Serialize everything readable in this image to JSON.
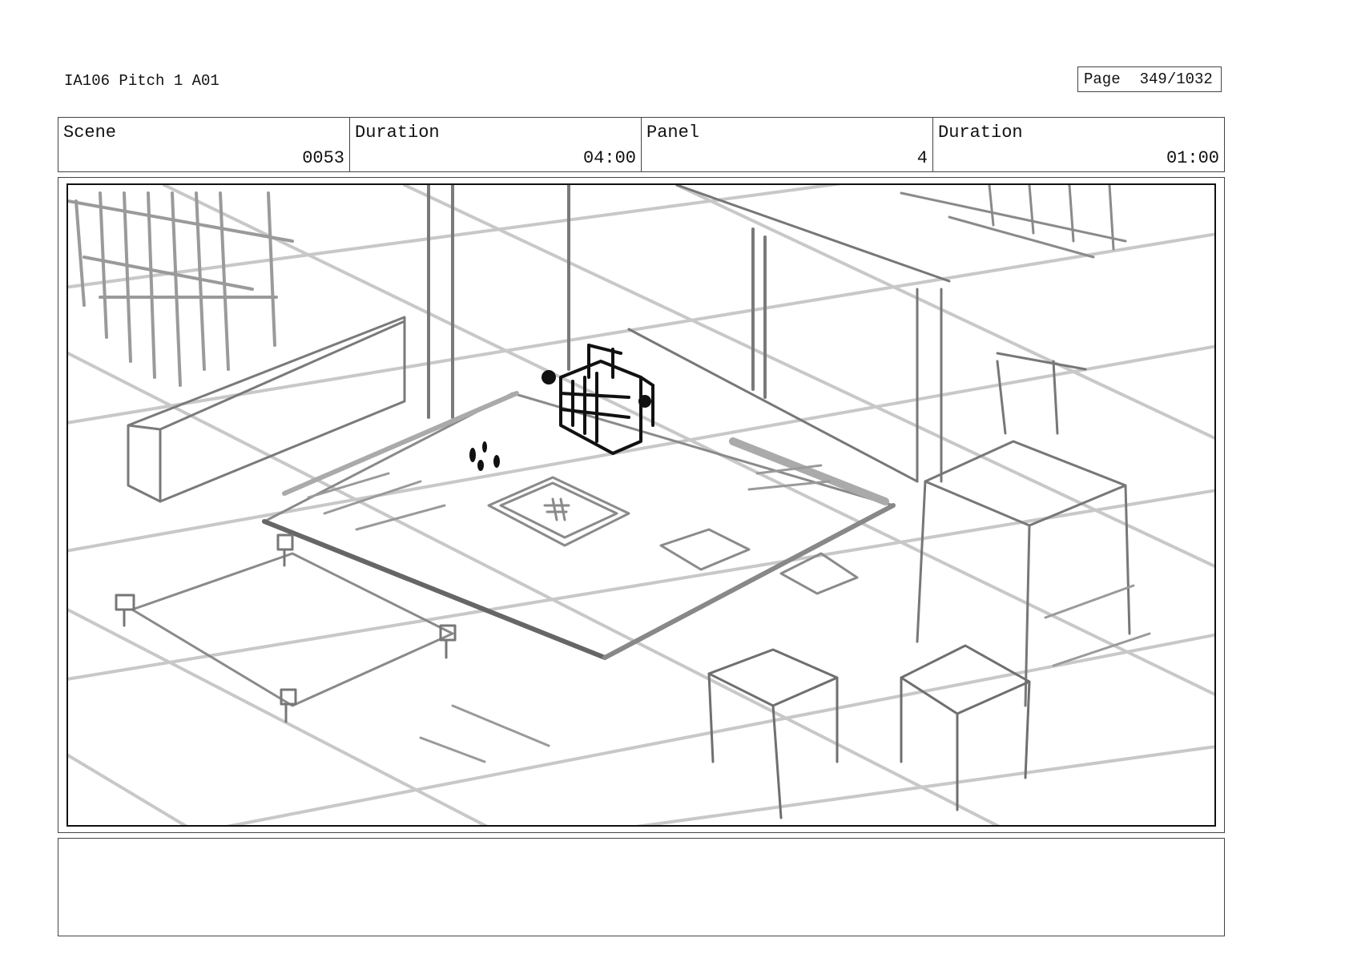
{
  "header": {
    "title": "IA106 Pitch 1 A01",
    "page_label": "Page",
    "page_value": "349/1032"
  },
  "info": {
    "scene_label": "Scene",
    "scene_value": "0053",
    "scene_duration_label": "Duration",
    "scene_duration_value": "04:00",
    "panel_label": "Panel",
    "panel_value": "4",
    "panel_duration_label": "Duration",
    "panel_duration_value": "01:00"
  },
  "notes": {
    "text": ""
  }
}
